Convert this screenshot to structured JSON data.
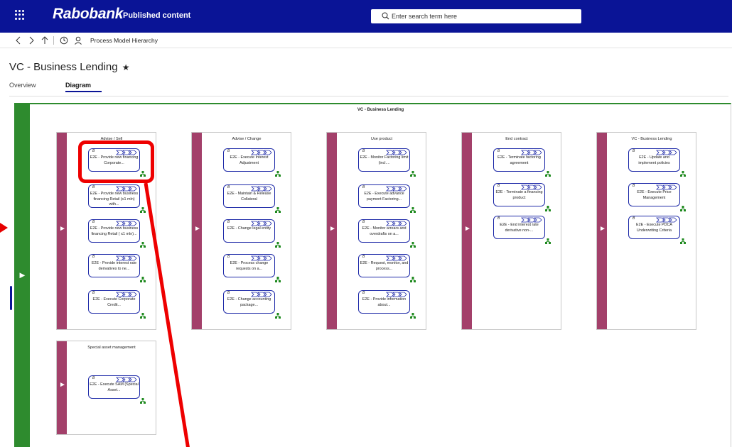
{
  "header": {
    "brand": "Rabobank",
    "app_name": "Published content",
    "search_placeholder": "Enter search term here"
  },
  "toolbar": {
    "breadcrumb": "Process Model Hierarchy"
  },
  "page": {
    "title": "VC - Business Lending",
    "star": "★"
  },
  "tabs": [
    {
      "label": "Overview",
      "active": false
    },
    {
      "label": "Diagram",
      "active": true
    }
  ],
  "diagram": {
    "title": "VC - Business Lending",
    "lanes": [
      {
        "title": "Advise / Sell",
        "boxes": [
          {
            "num": "B",
            "label": "E2E - Provide new financing Corporate..."
          },
          {
            "num": "B",
            "label": "E2E - Provide new business financing Retail (≤1 mln) with..."
          },
          {
            "num": "B",
            "label": "E2E - Provide new business financing Retail ( ≤1 mln)..."
          },
          {
            "num": "B",
            "label": "E2E - Provide interest rate derivatives to ne..."
          },
          {
            "num": "B",
            "label": "E2E - Execute Corporate Credit..."
          }
        ]
      },
      {
        "title": "Advise / Change",
        "boxes": [
          {
            "num": "B",
            "label": "E2E - Execute Interest Adjustment"
          },
          {
            "num": "B",
            "label": "E2E - Maintain & Release Collateral"
          },
          {
            "num": "B",
            "label": "E2E - Change legal entity"
          },
          {
            "num": "B",
            "label": "E2E - Process change requests on a..."
          },
          {
            "num": "B",
            "label": "E2E - Change accounting package..."
          }
        ]
      },
      {
        "title": "Use product",
        "boxes": [
          {
            "num": "B",
            "label": "E2E - Monitor Factoring limit (incl...."
          },
          {
            "num": "B",
            "label": "E2E - Execute advance payment Factoring..."
          },
          {
            "num": "B",
            "label": "E2E - Monitor arrears and overdrafts on a..."
          },
          {
            "num": "B",
            "label": "E2E - Request, monitor, and process..."
          },
          {
            "num": "B",
            "label": "E2E - Provide information about..."
          }
        ]
      },
      {
        "title": "End contract",
        "boxes": [
          {
            "num": "B",
            "label": "E2E - Terminate factoring agreement"
          },
          {
            "num": "B",
            "label": "E2E - Terminate a financing product"
          },
          {
            "num": "B",
            "label": "E2E - End interest rate derivative non-..."
          }
        ]
      },
      {
        "title": "VC - Business Lending",
        "boxes": [
          {
            "num": "B",
            "label": "E2E - Update and implement policies"
          },
          {
            "num": "B",
            "label": "E2E - Execute Price Management"
          },
          {
            "num": "B",
            "label": "E2E - Execute PDCA Underwriting Criteria"
          }
        ]
      },
      {
        "title": "Special asset management",
        "boxes": [
          {
            "num": "B",
            "label": "E2E - Execute SAM (Special Asset..."
          }
        ]
      }
    ]
  },
  "colors": {
    "header_bg": "#0a1496",
    "lane_bar": "#a3406a",
    "outer_bar": "#2e8b2e",
    "box_border": "#1e2aa8",
    "annotation": "#ee0000"
  },
  "icons": [
    "app-launcher-icon",
    "search-icon",
    "back-icon",
    "forward-icon",
    "up-icon",
    "history-icon",
    "user-icon",
    "chevron-arrows-icon",
    "subprocess-icon"
  ]
}
